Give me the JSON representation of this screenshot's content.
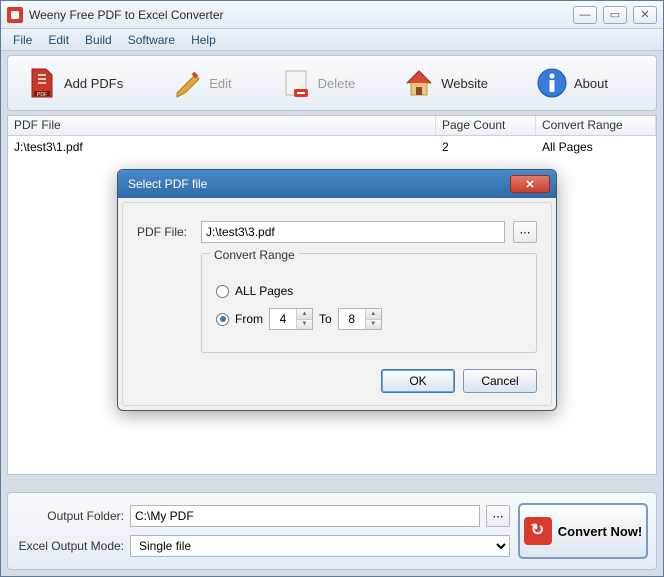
{
  "window": {
    "title": "Weeny Free PDF to Excel Converter"
  },
  "menu": {
    "file": "File",
    "edit": "Edit",
    "build": "Build",
    "software": "Software",
    "help": "Help"
  },
  "toolbar": {
    "add_pdfs": "Add PDFs",
    "edit": "Edit",
    "delete": "Delete",
    "website": "Website",
    "about": "About"
  },
  "table": {
    "headers": {
      "file": "PDF File",
      "pages": "Page Count",
      "range": "Convert Range"
    },
    "rows": [
      {
        "file": "J:\\test3\\1.pdf",
        "pages": "2",
        "range": "All Pages"
      }
    ]
  },
  "bottom": {
    "output_label": "Output Folder:",
    "output_value": "C:\\My PDF",
    "mode_label": "Excel Output Mode:",
    "mode_value": "Single file",
    "convert": "Convert Now!"
  },
  "dialog": {
    "title": "Select PDF file",
    "file_label": "PDF File:",
    "file_value": "J:\\test3\\3.pdf",
    "range_group": "Convert Range",
    "all_pages": "ALL Pages",
    "from_label": "From",
    "to_label": "To",
    "from_value": "4",
    "to_value": "8",
    "ok": "OK",
    "cancel": "Cancel"
  }
}
